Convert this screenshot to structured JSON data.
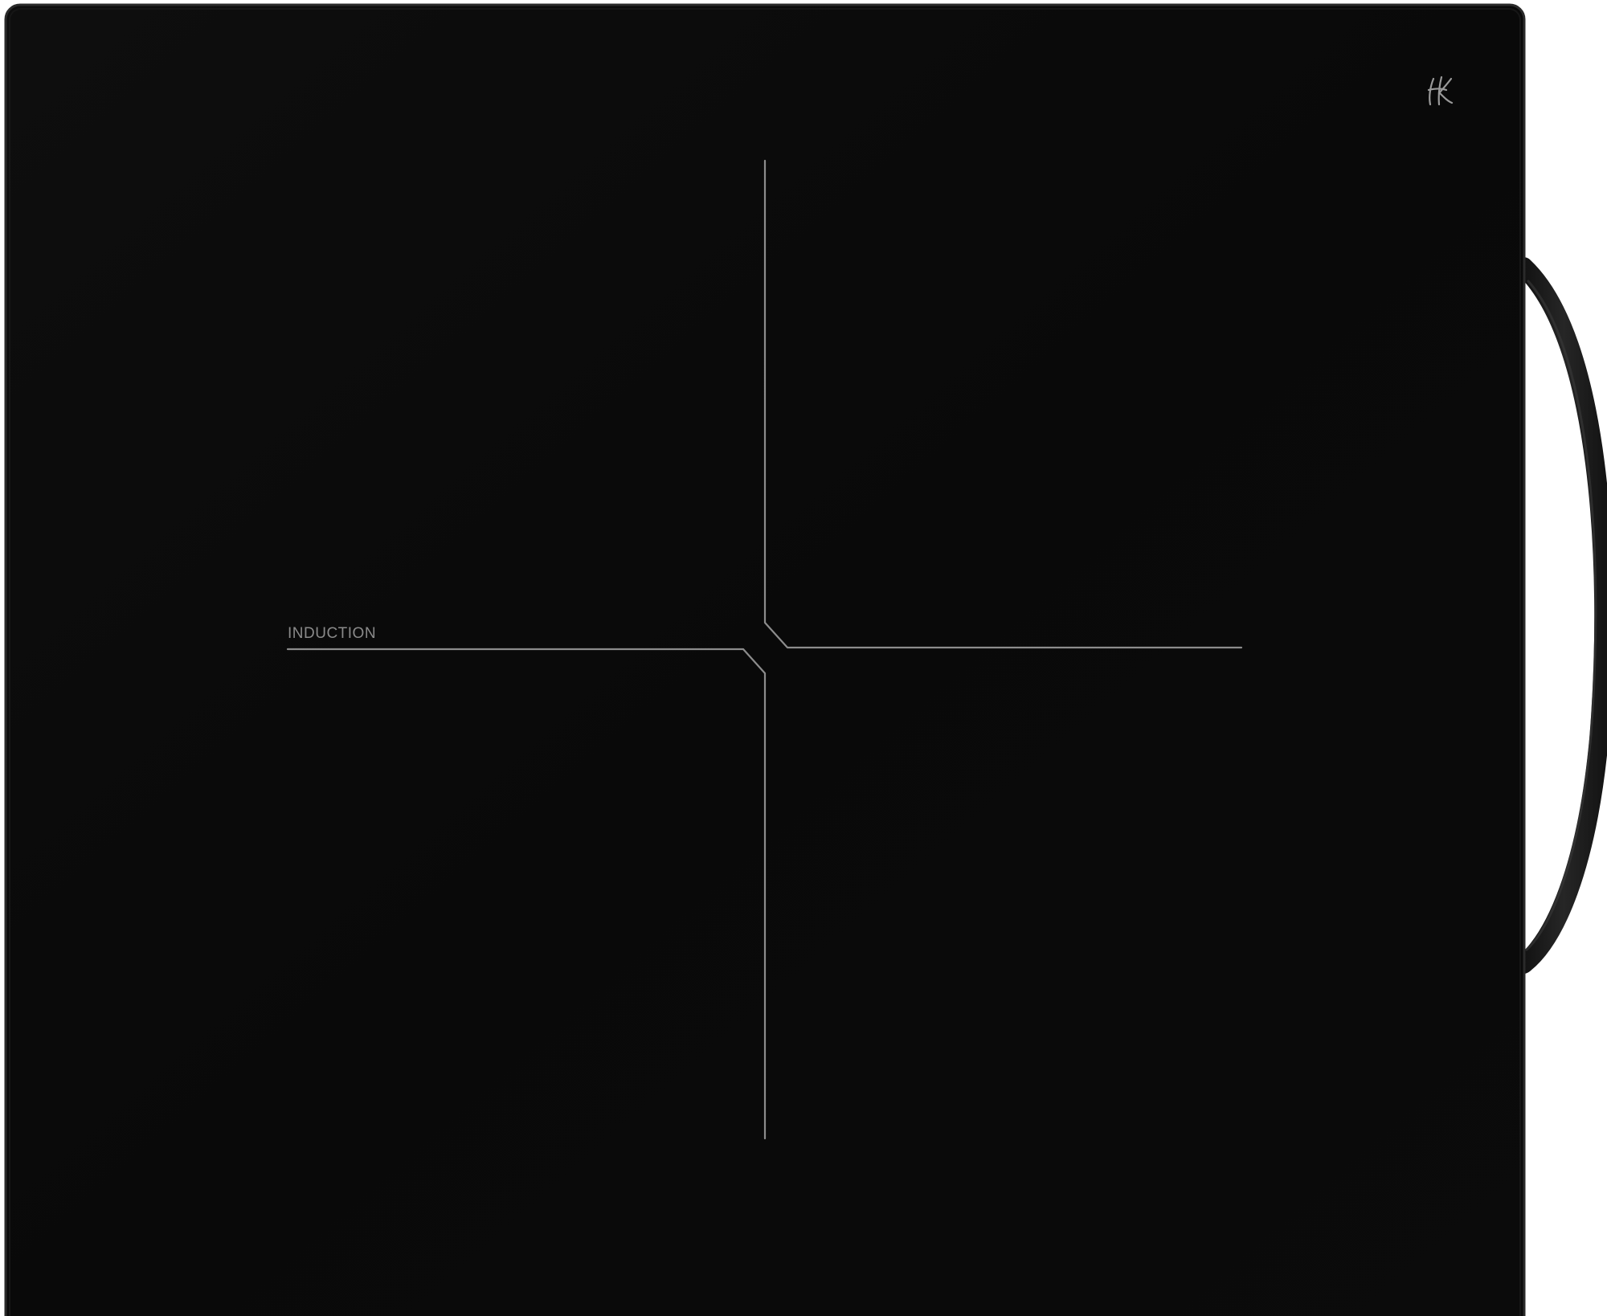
{
  "product": {
    "label": "INDUCTION",
    "logo": "hk-monogram-logo"
  },
  "colors": {
    "glass": "#0a0a0a",
    "glass_edge": "#2a2a2a",
    "handle": "#1b1b1b",
    "zone_lines": "#8c8c8c",
    "label": "#8a8a8a",
    "background": "#ffffff"
  }
}
